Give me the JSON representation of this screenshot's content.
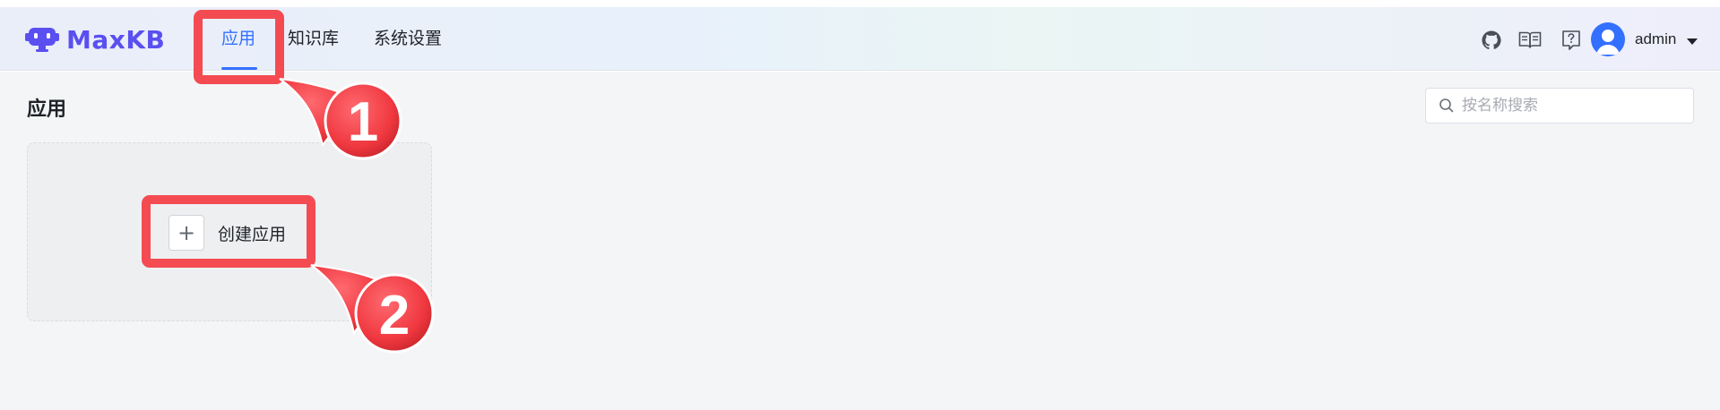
{
  "app": {
    "name": "MaxKB"
  },
  "nav": {
    "items": [
      {
        "label": "应用",
        "active": true
      },
      {
        "label": "知识库",
        "active": false
      },
      {
        "label": "系统设置",
        "active": false
      }
    ]
  },
  "header_icons": [
    "github-icon",
    "book-icon",
    "help-icon"
  ],
  "user": {
    "name": "admin"
  },
  "page": {
    "title": "应用"
  },
  "search": {
    "placeholder": "按名称搜索",
    "value": ""
  },
  "create": {
    "label": "创建应用"
  },
  "annotations": [
    {
      "number": "1"
    },
    {
      "number": "2"
    }
  ],
  "colors": {
    "accent": "#3370ff",
    "brand": "#5a4ff0",
    "annotation": "#f44b52"
  }
}
